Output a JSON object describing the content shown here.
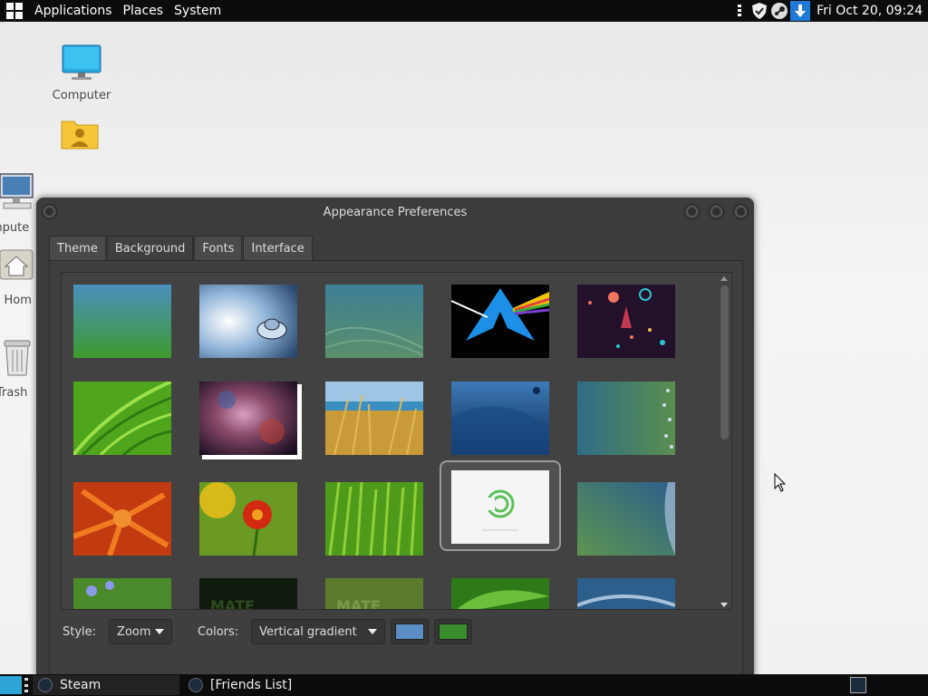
{
  "top_panel": {
    "menus": [
      "Applications",
      "Places",
      "System"
    ],
    "clock": "Fri Oct 20, 09:24",
    "tray_icons": [
      "shield-icon",
      "steam-icon",
      "download-arrow-icon"
    ]
  },
  "desktop": {
    "icons": [
      {
        "label": "Computer",
        "icon": "computer-icon"
      },
      {
        "label": "",
        "icon": "home-folder-icon"
      }
    ],
    "behind_icons": [
      {
        "label": "mpute",
        "icon": "computer-icon"
      },
      {
        "label": "'s Hom",
        "icon": "home-icon"
      },
      {
        "label": "Trash",
        "icon": "trash-icon"
      }
    ]
  },
  "window": {
    "title": "Appearance Preferences",
    "tabs": [
      "Theme",
      "Background",
      "Fonts",
      "Interface"
    ],
    "active_tab": "Background",
    "wallpapers": [
      {
        "name": "green-blue-gradient"
      },
      {
        "name": "water-drop"
      },
      {
        "name": "teal-waves"
      },
      {
        "name": "arch-prism"
      },
      {
        "name": "space-rocket"
      },
      {
        "name": "green-leaf"
      },
      {
        "name": "orion-nebula"
      },
      {
        "name": "grass-sky"
      },
      {
        "name": "blue-abstract"
      },
      {
        "name": "teal-bubbles"
      },
      {
        "name": "orange-flower"
      },
      {
        "name": "red-flower"
      },
      {
        "name": "grass-closeup"
      },
      {
        "name": "mate-logo-white",
        "selected": true
      },
      {
        "name": "green-blue-wave"
      },
      {
        "name": "blue-flowers"
      },
      {
        "name": "mate-dark"
      },
      {
        "name": "mate-green"
      },
      {
        "name": "green-leaves"
      },
      {
        "name": "blue-abstract-2"
      }
    ],
    "style_label": "Style:",
    "style_value": "Zoom",
    "colors_label": "Colors:",
    "colors_value": "Vertical gradient",
    "primary_color": "#5b8ec4",
    "secondary_color": "#3b8c2e"
  },
  "taskbar": {
    "tasks": [
      {
        "label": "Steam",
        "active": true
      },
      {
        "label": "[Friends List]",
        "active": false
      }
    ]
  }
}
